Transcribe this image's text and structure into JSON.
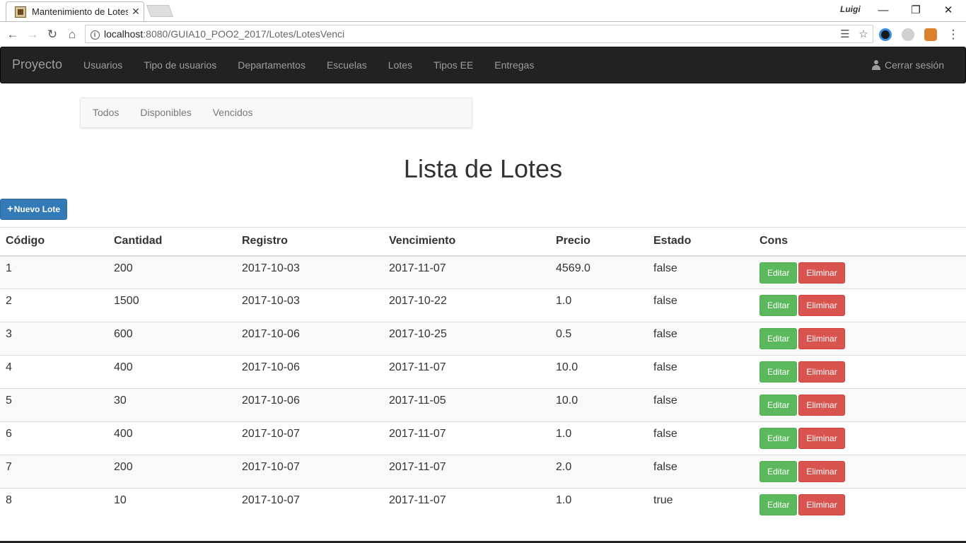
{
  "browser": {
    "tab_title": "Mantenimiento de Lotes",
    "tab_close": "✕",
    "user_name": "Luigi",
    "url_host": "localhost",
    "url_path": ":8080/GUIA10_POO2_2017/Lotes/LotesVenci"
  },
  "navbar": {
    "brand": "Proyecto",
    "links": [
      "Usuarios",
      "Tipo de usuarios",
      "Departamentos",
      "Escuelas",
      "Lotes",
      "Tipos EE",
      "Entregas"
    ],
    "logout_label": "Cerrar sesión"
  },
  "subnav": {
    "links": [
      "Todos",
      "Disponibles",
      "Vencidos"
    ]
  },
  "page": {
    "title": "Lista de Lotes",
    "new_button_label": "Nuevo Lote"
  },
  "table": {
    "headers": [
      "Código",
      "Cantidad",
      "Registro",
      "Vencimiento",
      "Precio",
      "Estado",
      "Cons"
    ],
    "edit_label": "Editar",
    "delete_label": "Eliminar",
    "rows": [
      [
        "1",
        "200",
        "2017-10-03",
        "2017-11-07",
        "4569.0",
        "false"
      ],
      [
        "2",
        "1500",
        "2017-10-03",
        "2017-10-22",
        "1.0",
        "false"
      ],
      [
        "3",
        "600",
        "2017-10-06",
        "2017-10-25",
        "0.5",
        "false"
      ],
      [
        "4",
        "400",
        "2017-10-06",
        "2017-11-07",
        "10.0",
        "false"
      ],
      [
        "5",
        "30",
        "2017-10-06",
        "2017-11-05",
        "10.0",
        "false"
      ],
      [
        "6",
        "400",
        "2017-10-07",
        "2017-11-07",
        "1.0",
        "false"
      ],
      [
        "7",
        "200",
        "2017-10-07",
        "2017-11-07",
        "2.0",
        "false"
      ],
      [
        "8",
        "10",
        "2017-10-07",
        "2017-11-07",
        "1.0",
        "true"
      ]
    ]
  },
  "colors": {
    "primary": "#337ab7",
    "success": "#5cb85c",
    "danger": "#d9534f",
    "navbar_bg": "#222222"
  }
}
